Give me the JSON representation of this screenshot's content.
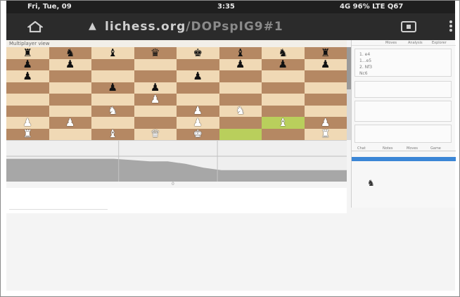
{
  "status_bar": {
    "left": "Fri, Tue, 09",
    "time": "3:35",
    "right": "4G  96%  LTE  Q67"
  },
  "url_bar": {
    "domain": "lichess.org",
    "path": "/DOPspIG9#1"
  },
  "board": {
    "header": "Multiplayer view",
    "rows": [
      [
        "bR",
        "bN",
        "bB",
        "bQ",
        "bK",
        "bB",
        "bN",
        "bR"
      ],
      [
        "bP",
        "bP",
        "",
        "",
        "",
        "bP",
        "bP",
        "bP"
      ],
      [
        "bP",
        "",
        "",
        "",
        "bP",
        "",
        "",
        ""
      ],
      [
        "",
        "",
        "bP",
        "bP",
        "",
        "",
        "",
        ""
      ],
      [
        "",
        "",
        "",
        "wP",
        "",
        "",
        "",
        ""
      ],
      [
        "",
        "",
        "wN",
        "",
        "wP",
        "wN",
        "",
        ""
      ],
      [
        "wP",
        "wP",
        "",
        "",
        "wP",
        "",
        "wB",
        "wP"
      ],
      [
        "wR",
        "",
        "wB",
        "wQ",
        "wK",
        "",
        "",
        "wR"
      ]
    ],
    "highlight_squares": [
      "f1",
      "g2"
    ]
  },
  "graph": {
    "axis_labels": [
      "",
      "0",
      "",
      "",
      ""
    ],
    "evaluation": [
      0.1,
      0.1,
      0.1,
      0.1,
      0.1,
      0.1,
      0.1,
      0.15,
      0.2,
      0.2,
      0.3,
      0.45,
      0.55,
      0.55,
      0.55,
      0.55,
      0.55,
      0.55,
      0.55,
      0.55
    ]
  },
  "side_panel": {
    "tabs": [
      "Moves",
      "Analysis",
      "Explorer"
    ],
    "lines": [
      "1. e4",
      "1...e5",
      "2. Nf3",
      "Nc6"
    ],
    "lower_tabs": [
      "Chat",
      "Notes",
      "Moves",
      "Game"
    ]
  },
  "colors": {
    "light_square": "#f0d9b5",
    "dark_square": "#b58863",
    "highlight": "#b9cf5c",
    "toolbar": "#2b2b2b"
  }
}
